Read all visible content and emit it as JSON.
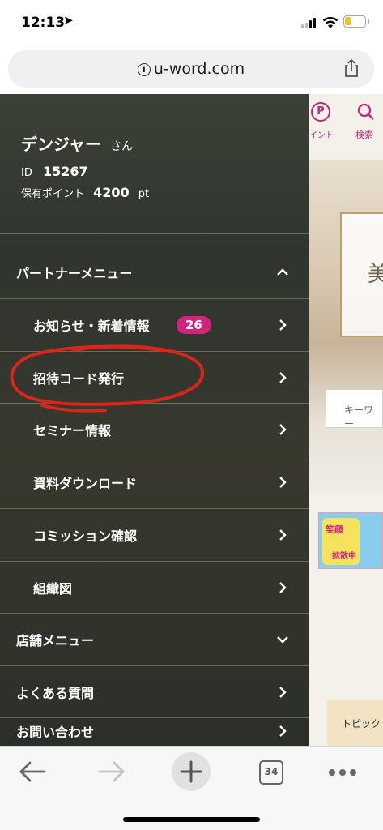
{
  "status": {
    "time": "12:13"
  },
  "browser": {
    "url": "u-word.com",
    "tab_count": "34"
  },
  "header_icons": {
    "points_label": "イント",
    "search_label": "検索"
  },
  "background": {
    "keyword_placeholder": "キーワー",
    "hero_char": "美",
    "banner_text1": "笑顔",
    "banner_text2": "拡散中",
    "topic_label": "トピック"
  },
  "user": {
    "name": "デンジャー",
    "suffix": "さん",
    "id_label": "ID",
    "id_value": "15267",
    "points_label": "保有ポイント",
    "points_value": "4200",
    "points_unit": "pt"
  },
  "menu": {
    "partner_menu": "パートナーメニュー",
    "items": [
      {
        "label": "お知らせ・新着情報",
        "badge": "26"
      },
      {
        "label": "招待コード発行"
      },
      {
        "label": "セミナー情報"
      },
      {
        "label": "資料ダウンロード"
      },
      {
        "label": "コミッション確認"
      },
      {
        "label": "組織図"
      }
    ],
    "store_menu": "店舗メニュー",
    "faq": "よくある質問",
    "contact": "お問い合わせ"
  },
  "colors": {
    "badge": "#d1247d",
    "annotation": "#d8261b",
    "accent": "#c0267a"
  }
}
